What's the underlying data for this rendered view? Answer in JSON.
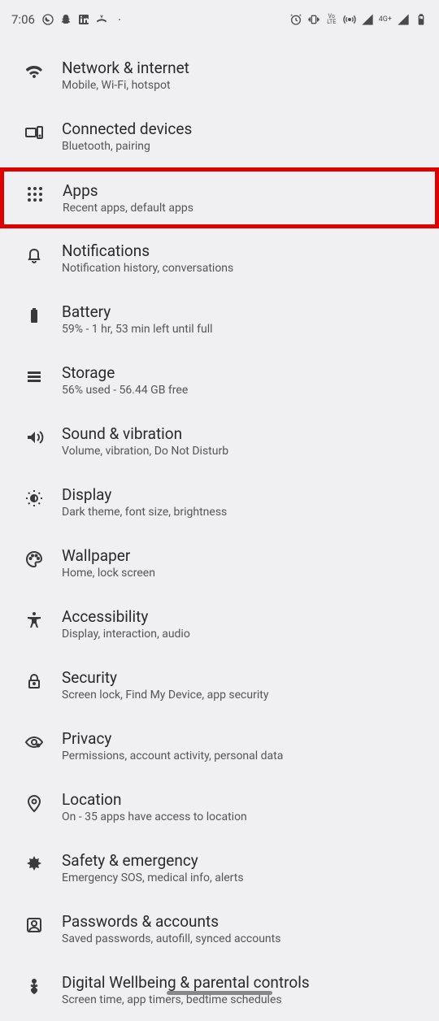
{
  "status": {
    "time": "7:06",
    "network_label": "4G+"
  },
  "settings": [
    {
      "icon": "wifi",
      "title": "Network & internet",
      "subtitle": "Mobile, Wi-Fi, hotspot",
      "highlighted": false
    },
    {
      "icon": "devices",
      "title": "Connected devices",
      "subtitle": "Bluetooth, pairing",
      "highlighted": false
    },
    {
      "icon": "apps",
      "title": "Apps",
      "subtitle": "Recent apps, default apps",
      "highlighted": true
    },
    {
      "icon": "bell",
      "title": "Notifications",
      "subtitle": "Notification history, conversations",
      "highlighted": false
    },
    {
      "icon": "battery",
      "title": "Battery",
      "subtitle": "59% - 1 hr, 53 min left until full",
      "highlighted": false
    },
    {
      "icon": "storage",
      "title": "Storage",
      "subtitle": "56% used - 56.44 GB free",
      "highlighted": false
    },
    {
      "icon": "sound",
      "title": "Sound & vibration",
      "subtitle": "Volume, vibration, Do Not Disturb",
      "highlighted": false
    },
    {
      "icon": "display",
      "title": "Display",
      "subtitle": "Dark theme, font size, brightness",
      "highlighted": false
    },
    {
      "icon": "palette",
      "title": "Wallpaper",
      "subtitle": "Home, lock screen",
      "highlighted": false
    },
    {
      "icon": "accessibility",
      "title": "Accessibility",
      "subtitle": "Display, interaction, audio",
      "highlighted": false
    },
    {
      "icon": "lock",
      "title": "Security",
      "subtitle": "Screen lock, Find My Device, app security",
      "highlighted": false
    },
    {
      "icon": "privacy",
      "title": "Privacy",
      "subtitle": "Permissions, account activity, personal data",
      "highlighted": false
    },
    {
      "icon": "location",
      "title": "Location",
      "subtitle": "On - 35 apps have access to location",
      "highlighted": false
    },
    {
      "icon": "medical",
      "title": "Safety & emergency",
      "subtitle": "Emergency SOS, medical info, alerts",
      "highlighted": false
    },
    {
      "icon": "account",
      "title": "Passwords & accounts",
      "subtitle": "Saved passwords, autofill, synced accounts",
      "highlighted": false
    },
    {
      "icon": "wellbeing",
      "title": "Digital Wellbeing & parental controls",
      "subtitle": "Screen time, app timers, bedtime schedules",
      "highlighted": false
    }
  ]
}
